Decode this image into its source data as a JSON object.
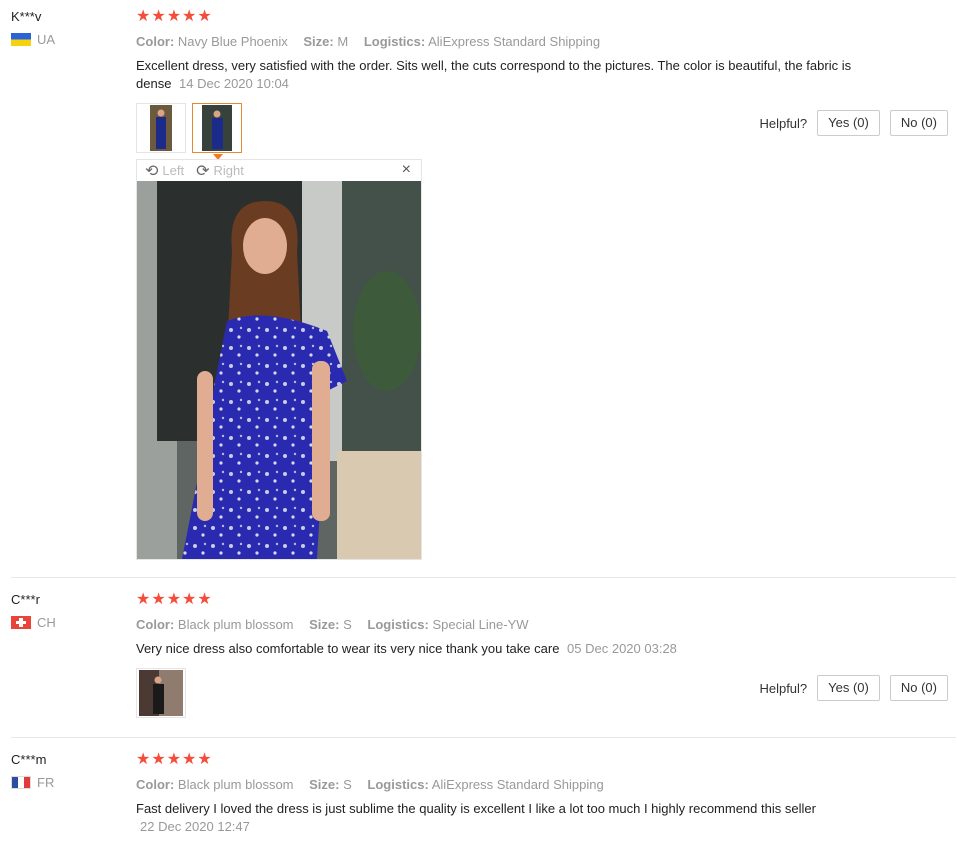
{
  "reviews": [
    {
      "user": "K***v",
      "country": "UA",
      "stars": "★★★★★",
      "color_label": "Color:",
      "color": "Navy Blue Phoenix",
      "size_label": "Size:",
      "size": "M",
      "logistics_label": "Logistics:",
      "logistics": "AliExpress Standard Shipping",
      "text": "Excellent dress, very satisfied with the order. Sits well, the cuts correspond to the pictures. The color is beautiful, the fabric is dense",
      "date": "14 Dec 2020 10:04",
      "helpful_label": "Helpful?",
      "yes": "Yes (0)",
      "no": "No (0)",
      "viewer": {
        "left": "Left",
        "right": "Right",
        "close": "×"
      }
    },
    {
      "user": "C***r",
      "country": "CH",
      "stars": "★★★★★",
      "color_label": "Color:",
      "color": "Black plum blossom",
      "size_label": "Size:",
      "size": "S",
      "logistics_label": "Logistics:",
      "logistics": "Special Line-YW",
      "text": "Very nice dress also comfortable to wear its very nice thank you take care",
      "date": "05 Dec 2020 03:28",
      "helpful_label": "Helpful?",
      "yes": "Yes (0)",
      "no": "No (0)"
    },
    {
      "user": "C***m",
      "country": "FR",
      "stars": "★★★★★",
      "color_label": "Color:",
      "color": "Black plum blossom",
      "size_label": "Size:",
      "size": "S",
      "logistics_label": "Logistics:",
      "logistics": "AliExpress Standard Shipping",
      "text": "Fast delivery I loved the dress is just sublime the quality is excellent I like a lot too much I highly recommend this seller",
      "date": "22 Dec 2020 12:47"
    }
  ],
  "icons": {
    "star": "star-icon",
    "rotate_left": "rotate-left-icon",
    "rotate_right": "rotate-right-icon",
    "close": "close-icon"
  }
}
